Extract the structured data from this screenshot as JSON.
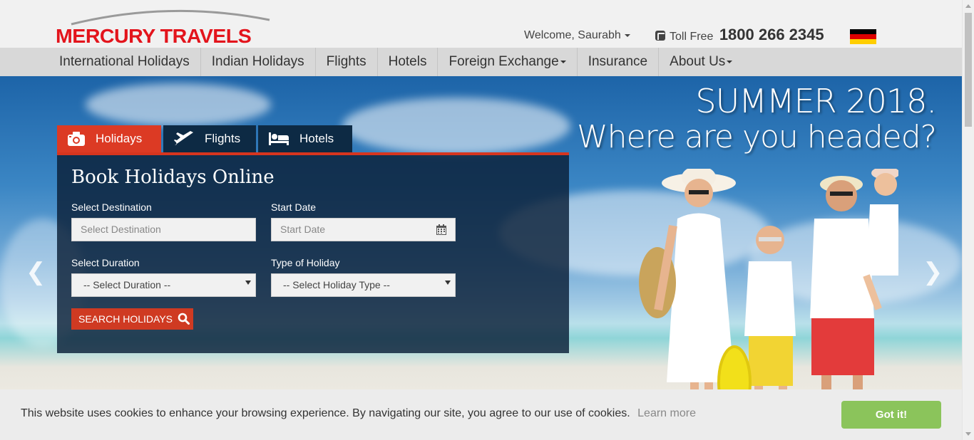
{
  "brand": {
    "logo_text": "MERCURY TRAVELS"
  },
  "header": {
    "welcome": "Welcome, Saurabh",
    "toll_free_label": "Toll Free",
    "toll_free_number": "1800 266 2345",
    "flag_colors": [
      "#000000",
      "#dd0000",
      "#ffce00"
    ]
  },
  "nav": {
    "items": [
      {
        "label": "International Holidays",
        "dropdown": false
      },
      {
        "label": "Indian Holidays",
        "dropdown": false
      },
      {
        "label": "Flights",
        "dropdown": false
      },
      {
        "label": "Hotels",
        "dropdown": false
      },
      {
        "label": "Foreign Exchange",
        "dropdown": true
      },
      {
        "label": "Insurance",
        "dropdown": false
      },
      {
        "label": "About Us",
        "dropdown": true
      }
    ]
  },
  "hero": {
    "headline_line1": "SUMMER 2018.",
    "headline_line2": "Where are you headed?"
  },
  "booking": {
    "tabs": [
      {
        "label": "Holidays",
        "icon": "camera-icon",
        "active": true
      },
      {
        "label": "Flights",
        "icon": "plane-icon",
        "active": false
      },
      {
        "label": "Hotels",
        "icon": "bed-icon",
        "active": false
      }
    ],
    "title": "Book Holidays Online",
    "destination": {
      "label": "Select Destination",
      "placeholder": "Select Destination"
    },
    "start_date": {
      "label": "Start Date",
      "placeholder": "Start Date"
    },
    "duration": {
      "label": "Select Duration",
      "value": "-- Select Duration --"
    },
    "holiday_type": {
      "label": "Type of Holiday",
      "value": "-- Select Holiday Type --"
    },
    "search_button": "SEARCH HOLIDAYS"
  },
  "cookie": {
    "message": "This website uses cookies to enhance your browsing experience. By navigating our site, you agree to our use of cookies.",
    "learn_more": "Learn more",
    "accept": "Got it!"
  },
  "colors": {
    "brand_red": "#e3141c",
    "accent_red": "#dc3a24",
    "panel_navy": "#0d2a44",
    "accept_green": "#8bc45b"
  }
}
